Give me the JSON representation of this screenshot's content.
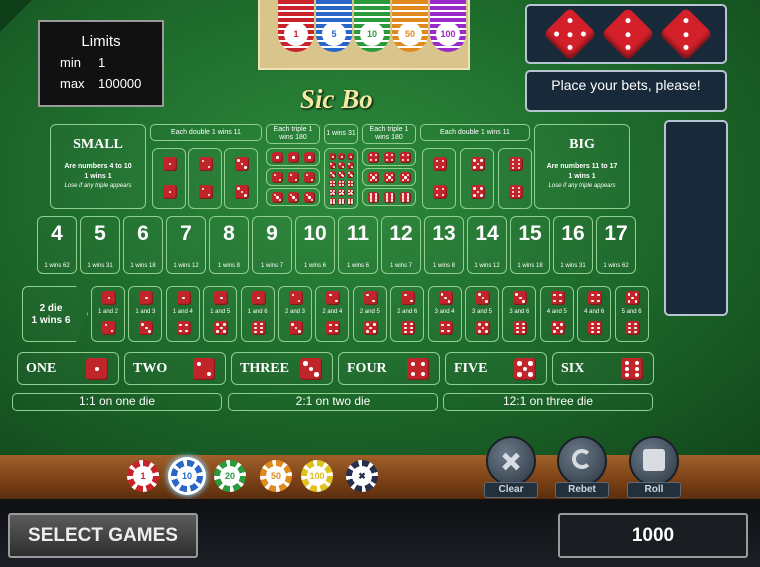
{
  "limits": {
    "title": "Limits",
    "min_label": "min",
    "min_value": "1",
    "max_label": "max",
    "max_value": "100000"
  },
  "logo": "Sic Bo",
  "message": "Place your bets, please!",
  "rack_chips": [
    {
      "value": "1",
      "color": "#c8222a"
    },
    {
      "value": "5",
      "color": "#2a66c8"
    },
    {
      "value": "10",
      "color": "#2b9a3a"
    },
    {
      "value": "50",
      "color": "#e08a1e"
    },
    {
      "value": "100",
      "color": "#9a2ac8"
    }
  ],
  "small": {
    "title": "SMALL",
    "line1": "Are numbers 4 to 10",
    "line2": "1 wins 1",
    "line3": "Lose if any triple appears"
  },
  "big": {
    "title": "BIG",
    "line1": "Are numbers 11 to 17",
    "line2": "1 wins 1",
    "line3": "Lose if any triple appears"
  },
  "headers": {
    "double_left": "Each double 1 wins 11",
    "triple_left": "Each triple 1 wins 180",
    "any_triple": "1 wins 31",
    "triple_right": "Each triple 1 wins 180",
    "double_right": "Each double 1 wins 11"
  },
  "totals": [
    {
      "n": "4",
      "p": "1 wins 62"
    },
    {
      "n": "5",
      "p": "1 wins 31"
    },
    {
      "n": "6",
      "p": "1 wins 18"
    },
    {
      "n": "7",
      "p": "1 wins 12"
    },
    {
      "n": "8",
      "p": "1 wins 8"
    },
    {
      "n": "9",
      "p": "1 wins 7"
    },
    {
      "n": "10",
      "p": "1 wins 6"
    },
    {
      "n": "11",
      "p": "1 wins 6"
    },
    {
      "n": "12",
      "p": "1 wins 7"
    },
    {
      "n": "13",
      "p": "1 wins 8"
    },
    {
      "n": "14",
      "p": "1 wins 12"
    },
    {
      "n": "15",
      "p": "1 wins 18"
    },
    {
      "n": "16",
      "p": "1 wins 31"
    },
    {
      "n": "17",
      "p": "1 wins 62"
    }
  ],
  "two_die": {
    "line1": "2 die",
    "line2": "1 wins 6"
  },
  "pairs": [
    {
      "label": "1 and 2",
      "a": 1,
      "b": 2
    },
    {
      "label": "1 and 3",
      "a": 1,
      "b": 3
    },
    {
      "label": "1 and 4",
      "a": 1,
      "b": 4
    },
    {
      "label": "1 and 5",
      "a": 1,
      "b": 5
    },
    {
      "label": "1 and 6",
      "a": 1,
      "b": 6
    },
    {
      "label": "2 and 3",
      "a": 2,
      "b": 3
    },
    {
      "label": "2 and 4",
      "a": 2,
      "b": 4
    },
    {
      "label": "2 and 5",
      "a": 2,
      "b": 5
    },
    {
      "label": "2 and 6",
      "a": 2,
      "b": 6
    },
    {
      "label": "3 and 4",
      "a": 3,
      "b": 4
    },
    {
      "label": "3 and 5",
      "a": 3,
      "b": 5
    },
    {
      "label": "3 and 6",
      "a": 3,
      "b": 6
    },
    {
      "label": "4 and 5",
      "a": 4,
      "b": 5
    },
    {
      "label": "4 and 6",
      "a": 4,
      "b": 6
    },
    {
      "label": "5 and 6",
      "a": 5,
      "b": 6
    }
  ],
  "singles": [
    {
      "label": "ONE",
      "face": 1
    },
    {
      "label": "TWO",
      "face": 2
    },
    {
      "label": "THREE",
      "face": 3
    },
    {
      "label": "FOUR",
      "face": 4
    },
    {
      "label": "FIVE",
      "face": 5
    },
    {
      "label": "SIX",
      "face": 6
    }
  ],
  "payouts": {
    "one": "1:1 on one die",
    "two": "2:1 on two die",
    "three": "12:1 on three die"
  },
  "chips": [
    {
      "value": "1",
      "color": "#c8222a",
      "selected": false
    },
    {
      "value": "10",
      "color": "#2a66c8",
      "selected": true
    },
    {
      "value": "20",
      "color": "#2b9a3a",
      "selected": false
    },
    {
      "value": "50",
      "color": "#e08a1e",
      "selected": false
    },
    {
      "value": "100",
      "color": "#e0c21e",
      "selected": false
    },
    {
      "value": "",
      "color": "#26304a",
      "selected": false
    }
  ],
  "controls": {
    "clear": "Clear",
    "rebet": "Rebet",
    "roll": "Roll"
  },
  "footer": {
    "select_games": "SELECT GAMES",
    "balance": "1000"
  },
  "result_dice": [
    5,
    3,
    3
  ]
}
